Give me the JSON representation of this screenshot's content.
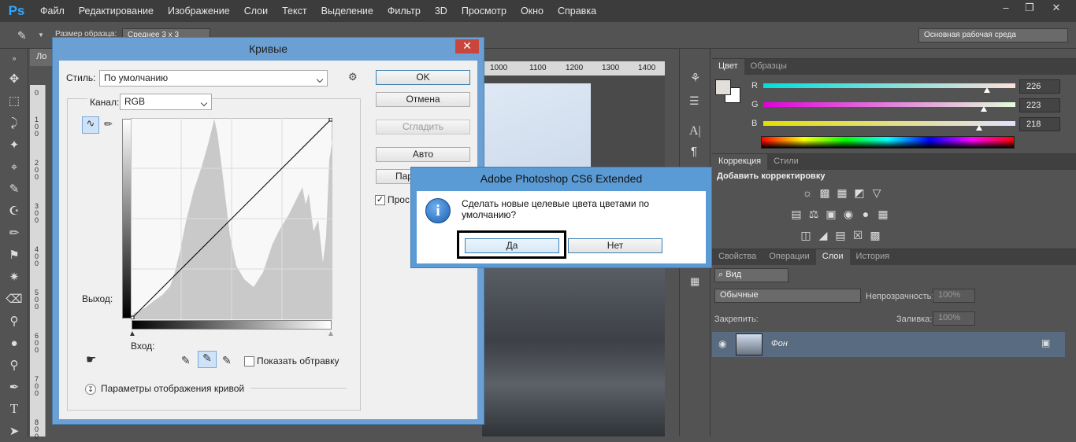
{
  "app": {
    "logo": "Ps"
  },
  "menu": [
    "Файл",
    "Редактирование",
    "Изображение",
    "Слои",
    "Текст",
    "Выделение",
    "Фильтр",
    "3D",
    "Просмотр",
    "Окно",
    "Справка"
  ],
  "options": {
    "sample_label": "Размер образца:",
    "sample_value": "Среднее 3 x 3",
    "workspace": "Основная рабочая среда"
  },
  "doc": {
    "tab_label": "Ло",
    "ruler_ticks": [
      "1000",
      "1100",
      "1200",
      "1300",
      "1400"
    ],
    "vruler_digits": [
      "0",
      "1 0 0",
      "2 0 0",
      "3 0 0",
      "4 0 0",
      "5 0 0",
      "6 0 0",
      "7 0 0",
      "8 0 0"
    ]
  },
  "curves": {
    "title": "Кривые",
    "style_label": "Стиль:",
    "style_value": "По умолчанию",
    "channel_label": "Канал:",
    "channel_value": "RGB",
    "output_label": "Выход:",
    "input_label": "Вход:",
    "show_clipping_label": "Показать обтравку",
    "display_options_label": "Параметры отображения кривой",
    "buttons": {
      "ok": "OK",
      "cancel": "Отмена",
      "smooth": "Сгладить",
      "auto": "Авто",
      "params": "Пара"
    },
    "preview_label": "Прос",
    "preview_checked": true
  },
  "message": {
    "title": "Adobe Photoshop CS6 Extended",
    "text": "Сделать новые целевые цвета цветами по умолчанию?",
    "yes": "Да",
    "no": "Нет"
  },
  "color_panel": {
    "tabs": [
      "Цвет",
      "Образцы"
    ],
    "channels": [
      {
        "label": "R",
        "value": "226",
        "level": 0.886
      },
      {
        "label": "G",
        "value": "223",
        "level": 0.875
      },
      {
        "label": "B",
        "value": "218",
        "level": 0.855
      }
    ],
    "fg_color": "#e2dfda"
  },
  "adjust_panel": {
    "tabs": [
      "Коррекция",
      "Стили"
    ],
    "heading": "Добавить корректировку"
  },
  "layers_panel": {
    "tabs": [
      "Свойства",
      "Операции",
      "Слои",
      "История"
    ],
    "filter": "Вид",
    "blend_mode": "Обычные",
    "opacity_label": "Непрозрачность:",
    "opacity_value": "100%",
    "lock_label": "Закрепить:",
    "fill_label": "Заливка:",
    "fill_value": "100%",
    "layers": [
      {
        "name": "Фон"
      }
    ]
  }
}
